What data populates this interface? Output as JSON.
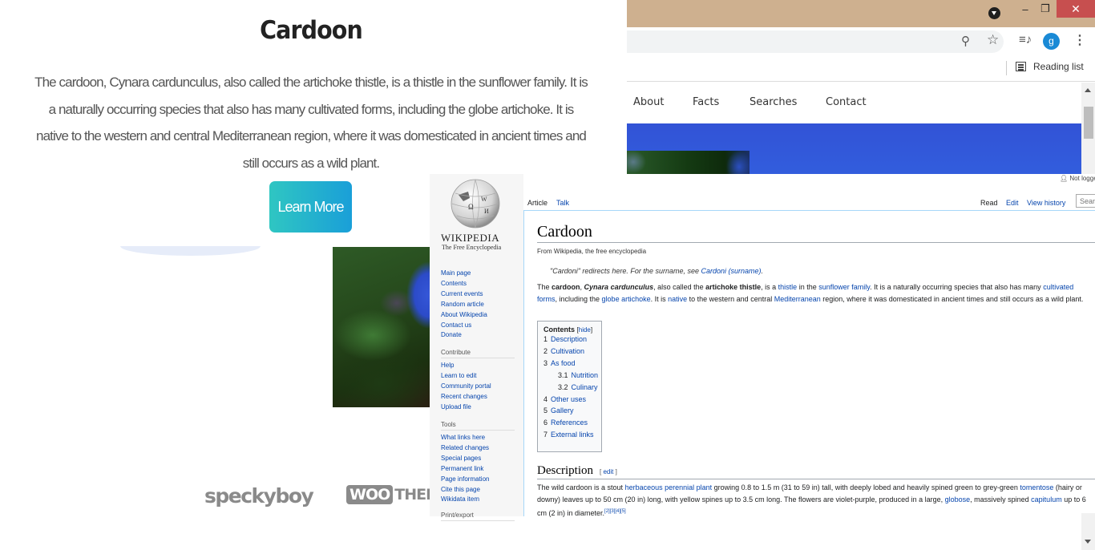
{
  "landing": {
    "title": "Cardoon",
    "description": "The cardoon, Cynara cardunculus, also called the artichoke thistle, is a thistle in the sunflower family. It is a naturally occurring species that also has many cultivated forms, including the globe artichoke. It is native to the western and central Mediterranean region, where it was domesticated in ancient times and still occurs as a wild plant.",
    "cta_label": "Learn More",
    "partner_logos": {
      "speckyboy": "speckyboy",
      "woo_badge": "WOO",
      "woo_text": "THEM"
    }
  },
  "browser": {
    "window_controls": {
      "minimize": "–",
      "maximize": "❐",
      "close": "✕"
    },
    "toolbar": {
      "zoom_icon": "⚲",
      "star_icon": "☆",
      "media_icon": "≡♪",
      "avatar_initial": "g",
      "menu_icon": "⋮"
    },
    "reading_list_label": "Reading list",
    "site_nav": [
      "About",
      "Facts",
      "Searches",
      "Contact"
    ],
    "colors": {
      "titlebar": "#ceb08f",
      "hero": "#3253d6",
      "close": "#c74f4f",
      "avatar": "#1a8ad6"
    }
  },
  "wikipedia": {
    "wordmark": "WIKIPEDIA",
    "tagline": "The Free Encyclopedia",
    "user_status": "Not logged in",
    "nav_main": [
      "Main page",
      "Contents",
      "Current events",
      "Random article",
      "About Wikipedia",
      "Contact us",
      "Donate"
    ],
    "contribute_heading": "Contribute",
    "nav_contribute": [
      "Help",
      "Learn to edit",
      "Community portal",
      "Recent changes",
      "Upload file"
    ],
    "tools_heading": "Tools",
    "nav_tools": [
      "What links here",
      "Related changes",
      "Special pages",
      "Permanent link",
      "Page information",
      "Cite this page",
      "Wikidata item"
    ],
    "next_heading": "Print/export",
    "tabs": {
      "article": "Article",
      "talk": "Talk",
      "read": "Read",
      "edit": "Edit",
      "history": "View history"
    },
    "search_placeholder": "Search",
    "article_title": "Cardoon",
    "from_line": "From Wikipedia, the free encyclopedia",
    "hatnote": {
      "prefix": "\"Cardoni\" redirects here. For the surname, see ",
      "link": "Cardoni (surname)",
      "suffix": "."
    },
    "intro": {
      "t1": "The ",
      "b1": "cardoon",
      "t2": ", ",
      "i1": "Cynara cardunculus",
      "t3": ", also called the ",
      "b2": "artichoke thistle",
      "t4": ", is a ",
      "l1": "thistle",
      "t5": " in the ",
      "l2": "sunflower family",
      "t6": ". It is a naturally occurring species that also has many ",
      "l3": "cultivated forms",
      "t7": ", including the ",
      "l4": "globe artichoke",
      "t8": ". It is ",
      "l5": "native",
      "t9": " to the western and central ",
      "l6": "Mediterranean",
      "t10": " region, where it was domesticated in ancient times and still occurs as a wild plant."
    },
    "toc": {
      "title": "Contents",
      "toggle": "hide",
      "items": [
        {
          "num": "1",
          "label": "Description",
          "sub": false
        },
        {
          "num": "2",
          "label": "Cultivation",
          "sub": false
        },
        {
          "num": "3",
          "label": "As food",
          "sub": false
        },
        {
          "num": "3.1",
          "label": "Nutrition",
          "sub": true
        },
        {
          "num": "3.2",
          "label": "Culinary",
          "sub": true
        },
        {
          "num": "4",
          "label": "Other uses",
          "sub": false
        },
        {
          "num": "5",
          "label": "Gallery",
          "sub": false
        },
        {
          "num": "6",
          "label": "References",
          "sub": false
        },
        {
          "num": "7",
          "label": "External links",
          "sub": false
        }
      ]
    },
    "description_heading": "Description",
    "edit_link": "edit",
    "description": {
      "t1": "The wild cardoon is a stout ",
      "l1": "herbaceous perennial plant",
      "t2": " growing 0.8 to 1.5 m (31 to 59 in) tall, with deeply lobed and heavily spined green to grey-green ",
      "l2": "tomentose",
      "t3": " (hairy or downy) leaves up to 50 cm (20 in) long, with yellow spines up to 3.5 cm long. The flowers are violet-purple, produced in a large, ",
      "l3": "globose",
      "t4": ", massively spined ",
      "l4": "capitulum",
      "t5": " up to 6 cm (2 in) in diameter.",
      "refs": "[2][3][4][5]"
    }
  }
}
